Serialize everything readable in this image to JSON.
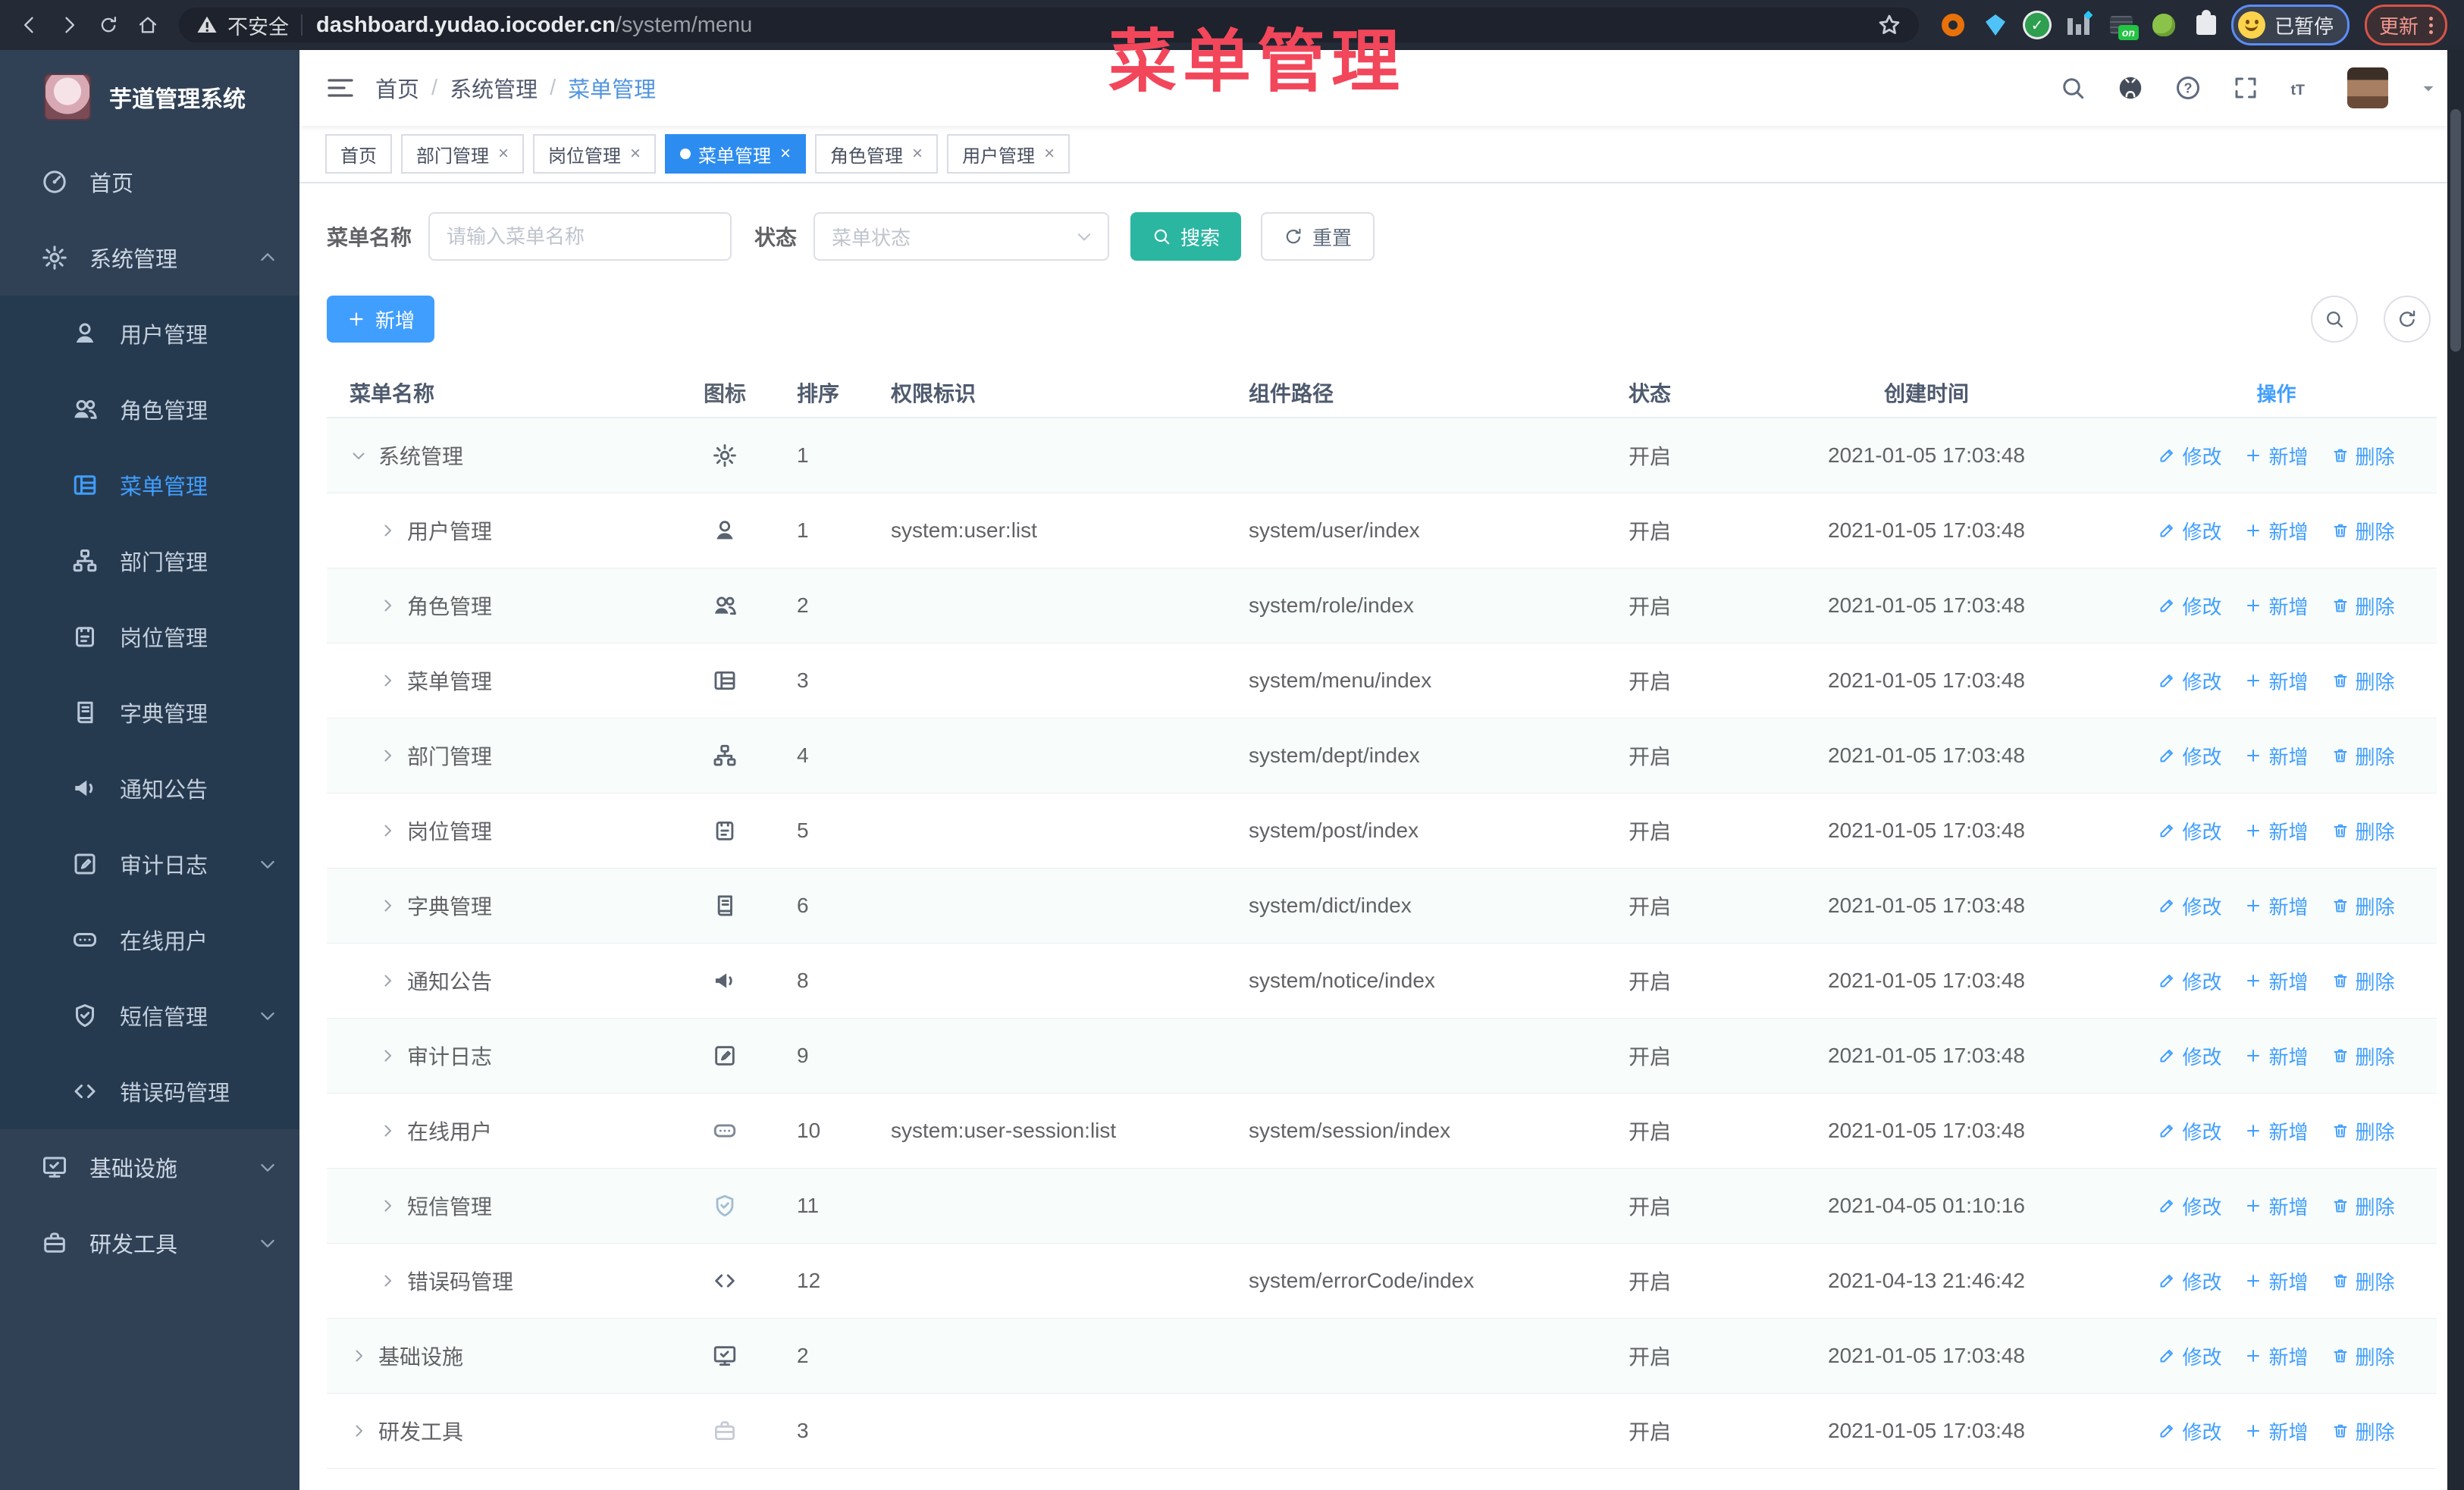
{
  "browser": {
    "security_label": "不安全",
    "url_host": "dashboard.yudao.iocoder.cn",
    "url_path": "/system/menu",
    "profile_badge": "已暂停",
    "update_label": "更新",
    "extensions": [
      "orange-ring-extension",
      "blue-gem-extension",
      "green-check-extension",
      "columns-extension",
      "screen-on-extension",
      "green-frog-extension",
      "puzzle-extension"
    ]
  },
  "overlay_title": "菜单管理",
  "sidebar": {
    "logo_title": "芋道管理系统",
    "items": [
      {
        "label": "首页",
        "icon": "dashboard",
        "type": "top"
      },
      {
        "label": "系统管理",
        "icon": "gear",
        "type": "top",
        "chevron": "up"
      },
      {
        "label": "用户管理",
        "icon": "user",
        "type": "sub"
      },
      {
        "label": "角色管理",
        "icon": "users",
        "type": "sub"
      },
      {
        "label": "菜单管理",
        "icon": "menu",
        "type": "sub",
        "active": true
      },
      {
        "label": "部门管理",
        "icon": "org",
        "type": "sub"
      },
      {
        "label": "岗位管理",
        "icon": "post",
        "type": "sub"
      },
      {
        "label": "字典管理",
        "icon": "dict",
        "type": "sub"
      },
      {
        "label": "通知公告",
        "icon": "notice",
        "type": "sub"
      },
      {
        "label": "审计日志",
        "icon": "log",
        "type": "sub",
        "chevron": "down"
      },
      {
        "label": "在线用户",
        "icon": "online",
        "type": "sub"
      },
      {
        "label": "短信管理",
        "icon": "sms",
        "type": "sub",
        "chevron": "down"
      },
      {
        "label": "错误码管理",
        "icon": "code",
        "type": "sub"
      },
      {
        "label": "基础设施",
        "icon": "infra",
        "type": "top",
        "chevron": "down"
      },
      {
        "label": "研发工具",
        "icon": "tool",
        "type": "top",
        "chevron": "down"
      }
    ]
  },
  "header": {
    "breadcrumb": [
      {
        "label": "首页",
        "sep": true
      },
      {
        "label": "系统管理",
        "sep": true
      },
      {
        "label": "菜单管理",
        "current": true
      }
    ]
  },
  "tabs": [
    {
      "label": "首页"
    },
    {
      "label": "部门管理",
      "closable": true
    },
    {
      "label": "岗位管理",
      "closable": true
    },
    {
      "label": "菜单管理",
      "closable": true,
      "active": true
    },
    {
      "label": "角色管理",
      "closable": true
    },
    {
      "label": "用户管理",
      "closable": true
    }
  ],
  "filters": {
    "name_label": "菜单名称",
    "name_placeholder": "请输入菜单名称",
    "status_label": "状态",
    "status_placeholder": "菜单状态",
    "search_label": "搜索",
    "reset_label": "重置"
  },
  "toolbar": {
    "add_label": "新增"
  },
  "table": {
    "columns": [
      "菜单名称",
      "图标",
      "排序",
      "权限标识",
      "组件路径",
      "状态",
      "创建时间",
      "操作"
    ],
    "action_labels": {
      "edit": "修改",
      "add": "新增",
      "delete": "删除"
    },
    "rows": [
      {
        "name": "系统管理",
        "level": 0,
        "expanded": true,
        "icon": "gear",
        "sort": "1",
        "perm": "",
        "path": "",
        "status": "开启",
        "created": "2021-01-05 17:03:48"
      },
      {
        "name": "用户管理",
        "level": 1,
        "icon": "user",
        "sort": "1",
        "perm": "system:user:list",
        "path": "system/user/index",
        "status": "开启",
        "created": "2021-01-05 17:03:48"
      },
      {
        "name": "角色管理",
        "level": 1,
        "icon": "users",
        "sort": "2",
        "perm": "",
        "path": "system/role/index",
        "status": "开启",
        "created": "2021-01-05 17:03:48"
      },
      {
        "name": "菜单管理",
        "level": 1,
        "icon": "menu",
        "sort": "3",
        "perm": "",
        "path": "system/menu/index",
        "status": "开启",
        "created": "2021-01-05 17:03:48"
      },
      {
        "name": "部门管理",
        "level": 1,
        "icon": "org",
        "sort": "4",
        "perm": "",
        "path": "system/dept/index",
        "status": "开启",
        "created": "2021-01-05 17:03:48"
      },
      {
        "name": "岗位管理",
        "level": 1,
        "icon": "post",
        "sort": "5",
        "perm": "",
        "path": "system/post/index",
        "status": "开启",
        "created": "2021-01-05 17:03:48"
      },
      {
        "name": "字典管理",
        "level": 1,
        "icon": "dict",
        "sort": "6",
        "perm": "",
        "path": "system/dict/index",
        "status": "开启",
        "created": "2021-01-05 17:03:48"
      },
      {
        "name": "通知公告",
        "level": 1,
        "icon": "notice",
        "sort": "8",
        "perm": "",
        "path": "system/notice/index",
        "status": "开启",
        "created": "2021-01-05 17:03:48"
      },
      {
        "name": "审计日志",
        "level": 1,
        "icon": "log",
        "sort": "9",
        "perm": "",
        "path": "",
        "status": "开启",
        "created": "2021-01-05 17:03:48"
      },
      {
        "name": "在线用户",
        "level": 1,
        "icon": "online",
        "sort": "10",
        "perm": "system:user-session:list",
        "path": "system/session/index",
        "status": "开启",
        "created": "2021-01-05 17:03:48"
      },
      {
        "name": "短信管理",
        "level": 1,
        "icon": "sms",
        "sort": "11",
        "perm": "",
        "path": "",
        "status": "开启",
        "created": "2021-04-05 01:10:16"
      },
      {
        "name": "错误码管理",
        "level": 1,
        "icon": "code",
        "sort": "12",
        "perm": "",
        "path": "system/errorCode/index",
        "status": "开启",
        "created": "2021-04-13 21:46:42"
      },
      {
        "name": "基础设施",
        "level": 0,
        "icon": "infra",
        "sort": "2",
        "perm": "",
        "path": "",
        "status": "开启",
        "created": "2021-01-05 17:03:48"
      },
      {
        "name": "研发工具",
        "level": 0,
        "icon": "tool",
        "sort": "3",
        "perm": "",
        "path": "",
        "status": "开启",
        "created": "2021-01-05 17:03:48"
      }
    ]
  },
  "colors": {
    "primary_blue": "#409eff",
    "active_tab_blue": "#2d8cf0",
    "search_button_teal": "#2bb6a1",
    "overlay_red": "#f2465a",
    "sidebar_bg": "#304156",
    "submenu_bg": "#263a4f",
    "browser_bar_bg": "#242a36",
    "link_blue": "#409eff"
  }
}
